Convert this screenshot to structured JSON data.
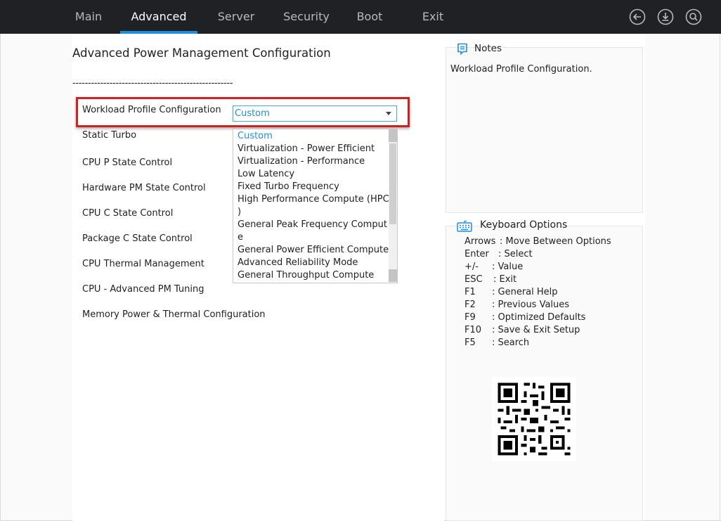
{
  "tabs": [
    {
      "label": "Main",
      "active": false
    },
    {
      "label": "Advanced",
      "active": true
    },
    {
      "label": "Server",
      "active": false
    },
    {
      "label": "Security",
      "active": false
    },
    {
      "label": "Boot",
      "active": false
    },
    {
      "label": "Exit",
      "active": false
    }
  ],
  "toolbar_icons": [
    "back-icon",
    "download-icon",
    "search-icon"
  ],
  "page": {
    "title": "Advanced Power Management Configuration",
    "divider": "----------------------------------------------------"
  },
  "menu_items": [
    "Workload Profile Configuration",
    "Static Turbo",
    "CPU P State Control",
    "Hardware PM State Control",
    "CPU C State Control",
    "Package C State Control",
    "CPU Thermal Management",
    "CPU - Advanced PM Tuning",
    "Memory Power & Thermal Configuration"
  ],
  "workload_select": {
    "value": "Custom",
    "options": [
      "Custom",
      "Virtualization - Power Efficient",
      "Virtualization - Performance",
      "Low Latency",
      "Fixed Turbo Frequency",
      "High Performance Compute (HPC",
      ")",
      "General Peak Frequency Comput",
      "e",
      "General Power Efficient Compute",
      "Advanced Reliability Mode",
      "General Throughput Compute"
    ]
  },
  "notes": {
    "title": "Notes",
    "text": "Workload Profile Configuration."
  },
  "keyboard": {
    "title": "Keyboard Options",
    "items": [
      {
        "key": "Arrows",
        "desc": ": Move Between Options"
      },
      {
        "key": "Enter",
        "desc": ": Select"
      },
      {
        "key": "+/-",
        "desc": ": Value"
      },
      {
        "key": "ESC",
        "desc": ": Exit"
      },
      {
        "key": "F1",
        "desc": ": General Help"
      },
      {
        "key": "F2",
        "desc": ": Previous Values"
      },
      {
        "key": "F9",
        "desc": ": Optimized Defaults"
      },
      {
        "key": "F10",
        "desc": ": Save & Exit Setup"
      },
      {
        "key": "F5",
        "desc": ": Search"
      }
    ]
  },
  "colors": {
    "accent": "#1f8fdc",
    "topbar": "#202124",
    "highlight": "#d21f1f"
  }
}
